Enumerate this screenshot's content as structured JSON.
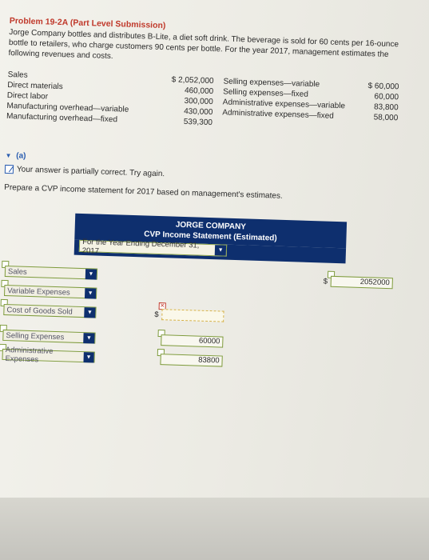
{
  "problem": {
    "title": "Problem 19-2A (Part Level Submission)",
    "intro": "Jorge Company bottles and distributes B-Lite, a diet soft drink. The beverage is sold for 60 cents per 16-ounce bottle to retailers, who charge customers 90 cents per bottle. For the year 2017, management estimates the following revenues and costs."
  },
  "costs": {
    "left_labels": [
      "Sales",
      "Direct materials",
      "Direct labor",
      "Manufacturing overhead—variable",
      "Manufacturing overhead—fixed"
    ],
    "left_values": [
      "$ 2,052,000",
      "460,000",
      "300,000",
      "430,000",
      "539,300"
    ],
    "right_labels": [
      "Selling expenses—variable",
      "Selling expenses—fixed",
      "Administrative expenses—variable",
      "Administrative expenses—fixed"
    ],
    "right_values": [
      "$ 60,000",
      "60,000",
      "83,800",
      "58,000"
    ]
  },
  "part_a": {
    "label": "(a)",
    "feedback": "Your answer is partially correct.  Try again.",
    "prompt": "Prepare a CVP income statement for 2017 based on management's estimates."
  },
  "statement": {
    "company": "JORGE COMPANY",
    "title": "CVP Income Statement (Estimated)",
    "period": "For the Year Ending December 31, 2017",
    "rows": [
      {
        "label": "Sales"
      },
      {
        "label": "Variable Expenses"
      },
      {
        "label": "Cost of Goods Sold"
      },
      {
        "label": "Selling Expenses"
      },
      {
        "label": "Administrative Expenses"
      }
    ],
    "sales_amount": "2052000",
    "selling_amount": "60000",
    "admin_amount": "83800",
    "dollar_sign": "$"
  },
  "colors": {
    "title_red": "#c0392b",
    "header_navy": "#0e2f6e",
    "link_blue": "#2a5db0",
    "correct_green": "#7e9b3c"
  }
}
